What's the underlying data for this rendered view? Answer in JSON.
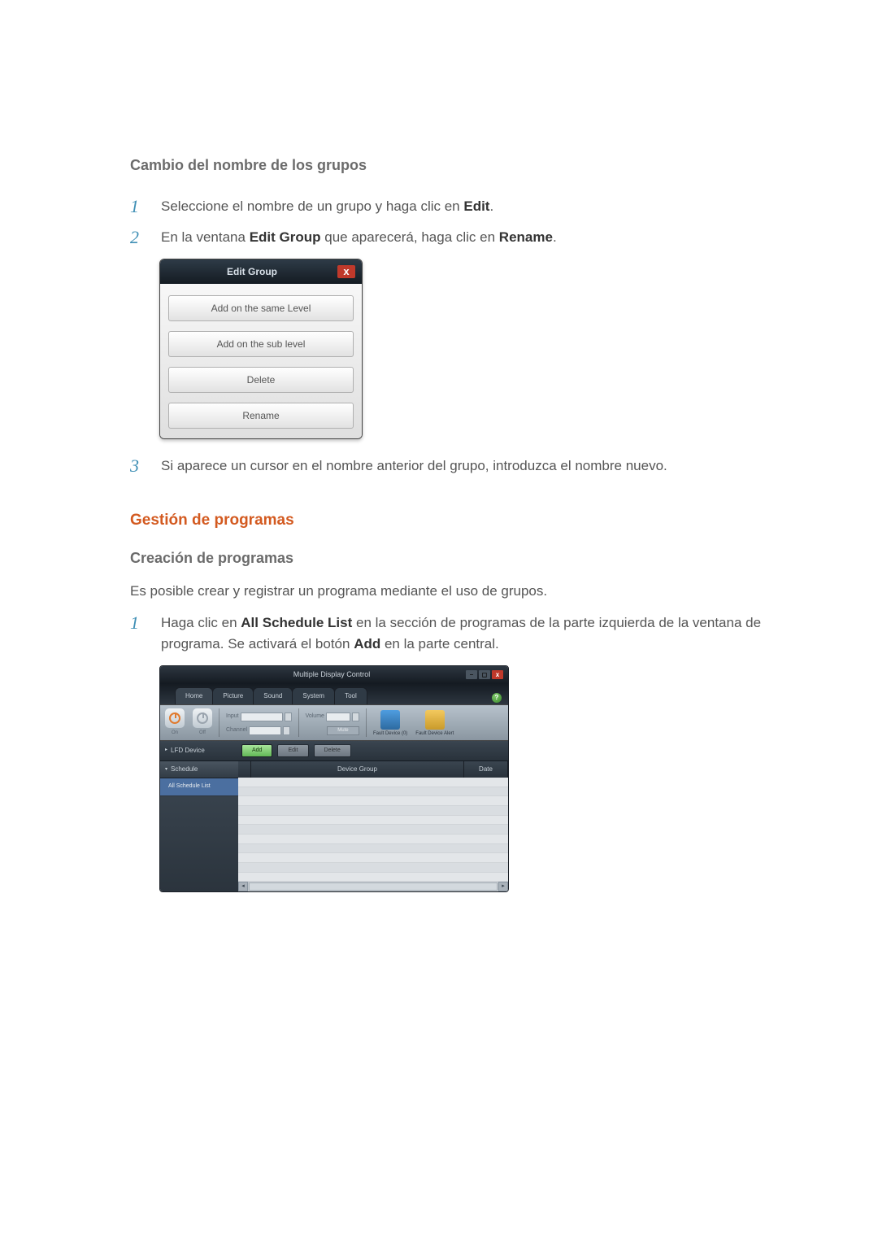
{
  "section1": {
    "title": "Cambio del nombre de los grupos",
    "steps": [
      {
        "num": "1",
        "text_a": "Seleccione el nombre de un grupo y haga clic en ",
        "bold": "Edit",
        "text_b": "."
      },
      {
        "num": "2",
        "text_a": "En la ventana ",
        "bold1": "Edit Group",
        "mid": " que aparecerá, haga clic en ",
        "bold2": "Rename",
        "text_b": "."
      },
      {
        "num": "3",
        "text_a": "Si aparece un cursor en el nombre anterior del grupo, introduzca el nombre nuevo."
      }
    ]
  },
  "dialog": {
    "title": "Edit Group",
    "close": "x",
    "buttons": [
      "Add on the same Level",
      "Add on the sub level",
      "Delete",
      "Rename"
    ]
  },
  "heading2": "Gestión de programas",
  "subsection": {
    "title": "Creación de programas",
    "intro": "Es posible crear y registrar un programa mediante el uso de grupos.",
    "step": {
      "num": "1",
      "a": "Haga clic en ",
      "b1": "All Schedule List",
      "mid": " en la sección de programas de la parte izquierda de la ventana de programa. Se activará el botón ",
      "b2": "Add",
      "end": " en la parte central."
    }
  },
  "mdc": {
    "title": "Multiple Display Control",
    "minimize": "–",
    "maximize": "◻",
    "close": "x",
    "help": "?",
    "tabs": [
      "Home",
      "Picture",
      "Sound",
      "System",
      "Tool"
    ],
    "ribbon": {
      "on": "On",
      "off": "Off",
      "input": "Input",
      "channel": "Channel",
      "volume": "Volume",
      "mute": "Mute",
      "fault0": "Fault Device (0)",
      "fault_alert": "Fault Device Alert"
    },
    "toolbar": {
      "lfd": "LFD Device",
      "add": "Add",
      "edit": "Edit",
      "delete": "Delete"
    },
    "side": {
      "schedule": "Schedule",
      "all": "All Schedule List"
    },
    "table": {
      "devicegroup": "Device Group",
      "date": "Date"
    }
  }
}
